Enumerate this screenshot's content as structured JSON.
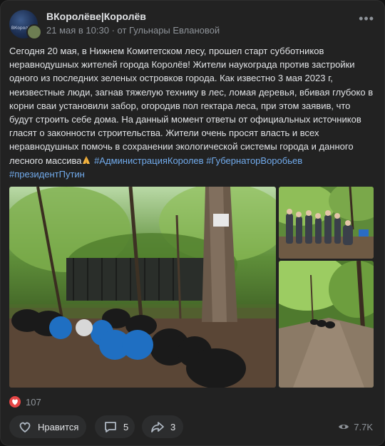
{
  "post": {
    "author": "ВКоролёве|Королёв",
    "date": "21 мая в 10:30",
    "source": "от Гульнары Евлановой",
    "avatar_text": "ВКоролёве",
    "text_main": "Сегодня 20 мая, в Нижнем Комитетском лесу, прошел старт субботников неравнодушных жителей города Королёв! Жители наукограда против застройки одного из последних зеленых островков города. Как известно 3 мая 2023 г, неизвестные люди, загнав тяжелую технику в лес, ломая деревья, вбивая глубоко в корни сваи установили забор, огородив пол гектара леса, при этом заявив, что будут строить себе дома. На данный момент ответы от официальных источников гласят о законности строительства. Жители очень просят власть и всех неравнодушных помочь в сохранении экологической системы города и данного лесного массива",
    "hashtags": [
      "#АдминистрацияКоролев",
      "#ГубернаторВоробьев",
      "#президентПутин"
    ]
  },
  "photos": [
    {
      "name": "forest-garbage-bags-photo"
    },
    {
      "name": "volunteers-group-photo"
    },
    {
      "name": "forest-path-photo"
    }
  ],
  "reactions": {
    "count": "107"
  },
  "actions": {
    "like_label": "Нравится",
    "comments": "5",
    "shares": "3",
    "views": "7.7K"
  },
  "colors": {
    "background": "#222222",
    "link": "#71aaeb",
    "muted": "#8e9399",
    "heart": "#e64646"
  },
  "icons": [
    "more-icon",
    "heart-icon",
    "comment-icon",
    "share-icon",
    "eye-icon",
    "pray-emoji-icon"
  ]
}
